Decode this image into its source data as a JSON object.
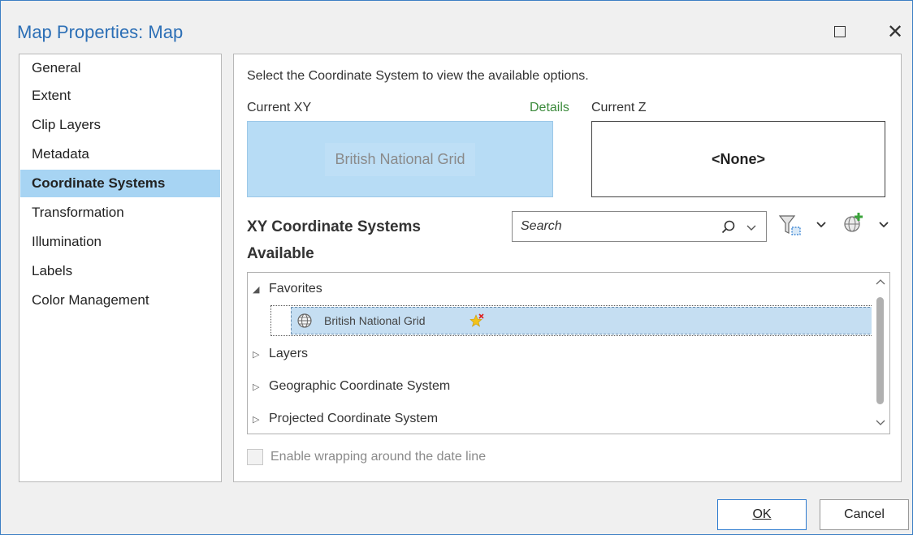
{
  "window": {
    "title": "Map Properties: Map"
  },
  "sidebar": {
    "items": [
      {
        "label": "General"
      },
      {
        "label": "Extent"
      },
      {
        "label": "Clip Layers"
      },
      {
        "label": "Metadata"
      },
      {
        "label": "Coordinate Systems",
        "active": true
      },
      {
        "label": "Transformation"
      },
      {
        "label": "Illumination"
      },
      {
        "label": "Labels"
      },
      {
        "label": "Color Management"
      }
    ]
  },
  "main": {
    "hint": "Select the Coordinate System to view the available options.",
    "current_xy_label": "Current XY",
    "details_link": "Details",
    "current_xy_value": "British National Grid",
    "current_z_label": "Current Z",
    "current_z_value": "<None>",
    "available_heading": "XY Coordinate Systems Available",
    "search_placeholder": "Search",
    "tree": {
      "favorites": "Favorites",
      "favorite_item": "British National Grid",
      "layers": "Layers",
      "geographic": "Geographic Coordinate System",
      "projected": "Projected Coordinate System"
    },
    "wrap_checkbox_label": "Enable wrapping around the date line"
  },
  "footer": {
    "ok_label": "OK",
    "cancel_label": "Cancel"
  },
  "colors": {
    "accent": "#2c6fb6",
    "selection": "#a7d4f3",
    "details": "#3b8a3b"
  }
}
